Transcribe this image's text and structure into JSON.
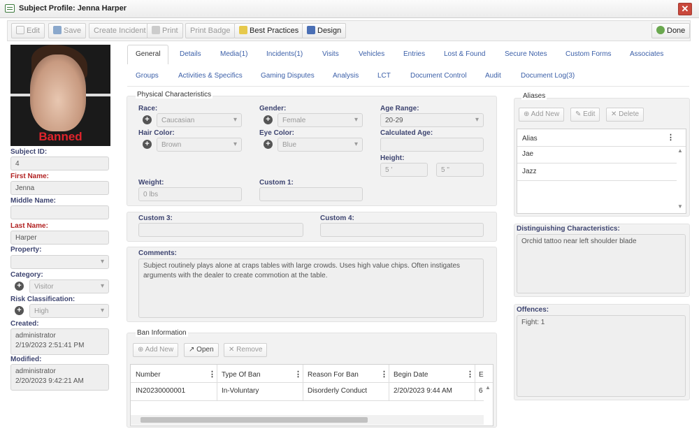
{
  "window": {
    "title": "Subject Profile: Jenna Harper",
    "close_glyph": "✕"
  },
  "toolbar": {
    "edit": "Edit",
    "save": "Save",
    "create_incident": "Create Incident",
    "print": "Print",
    "print_badge": "Print Badge",
    "best_practices": "Best Practices",
    "design": "Design",
    "done": "Done"
  },
  "photo": {
    "overlay": "Banned",
    "overlay_color": "#e0242c"
  },
  "left": {
    "subject_id_label": "Subject ID:",
    "subject_id": "4",
    "first_name_label": "First Name:",
    "first_name": "Jenna",
    "middle_name_label": "Middle Name:",
    "middle_name": "",
    "last_name_label": "Last Name:",
    "last_name": "Harper",
    "property_label": "Property:",
    "property": "",
    "category_label": "Category:",
    "category": "Visitor",
    "risk_label": "Risk Classification:",
    "risk": "High",
    "created_label": "Created:",
    "created_by": "administrator",
    "created_at": "2/19/2023 2:51:41 PM",
    "modified_label": "Modified:",
    "modified_by": "administrator",
    "modified_at": "2/20/2023 9:42:21 AM"
  },
  "tabs": {
    "row1": [
      "General",
      "Details",
      "Media(1)",
      "Incidents(1)",
      "Visits",
      "Vehicles",
      "Entries",
      "Lost & Found",
      "Secure Notes",
      "Custom Forms",
      "Associates"
    ],
    "row2": [
      "Groups",
      "Activities & Specifics",
      "Gaming Disputes",
      "Analysis",
      "LCT",
      "Document Control",
      "Audit",
      "Document Log(3)"
    ],
    "active": "General"
  },
  "physical": {
    "title": "Physical Characteristics",
    "race_label": "Race:",
    "race": "Caucasian",
    "gender_label": "Gender:",
    "gender": "Female",
    "age_range_label": "Age Range:",
    "age_range": "20-29",
    "hair_label": "Hair Color:",
    "hair": "Brown",
    "eye_label": "Eye Color:",
    "eye": "Blue",
    "calc_age_label": "Calculated Age:",
    "calc_age": "",
    "height_label": "Height:",
    "height_ft": "5 '",
    "height_in": "5 \"",
    "weight_label": "Weight:",
    "weight": "0 lbs",
    "custom1_label": "Custom 1:",
    "custom1": ""
  },
  "custom": {
    "custom3_label": "Custom 3:",
    "custom3": "",
    "custom4_label": "Custom 4:",
    "custom4": ""
  },
  "comments": {
    "label": "Comments:",
    "text": "Subject routinely plays alone at craps tables with large crowds. Uses high value chips. Often instigates arguments with the dealer to create commotion at the table."
  },
  "ban": {
    "title": "Ban Information",
    "add": "Add New",
    "open": "Open",
    "remove": "Remove",
    "columns": [
      "Number",
      "Type Of Ban",
      "Reason For Ban",
      "Begin Date",
      "E"
    ],
    "rows": [
      [
        "IN20230000001",
        "In-Voluntary",
        "Disorderly Conduct",
        "2/20/2023 9:44 AM",
        "6"
      ]
    ]
  },
  "aliases": {
    "title": "Aliases",
    "add": "Add New",
    "edit": "Edit",
    "delete": "Delete",
    "column": "Alias",
    "items": [
      "Jae",
      "Jazz"
    ]
  },
  "distinguishing": {
    "label": "Distinguishing Characteristics:",
    "text": "Orchid tattoo near left shoulder blade"
  },
  "offences": {
    "label": "Offences:",
    "text": "Fight: 1"
  }
}
